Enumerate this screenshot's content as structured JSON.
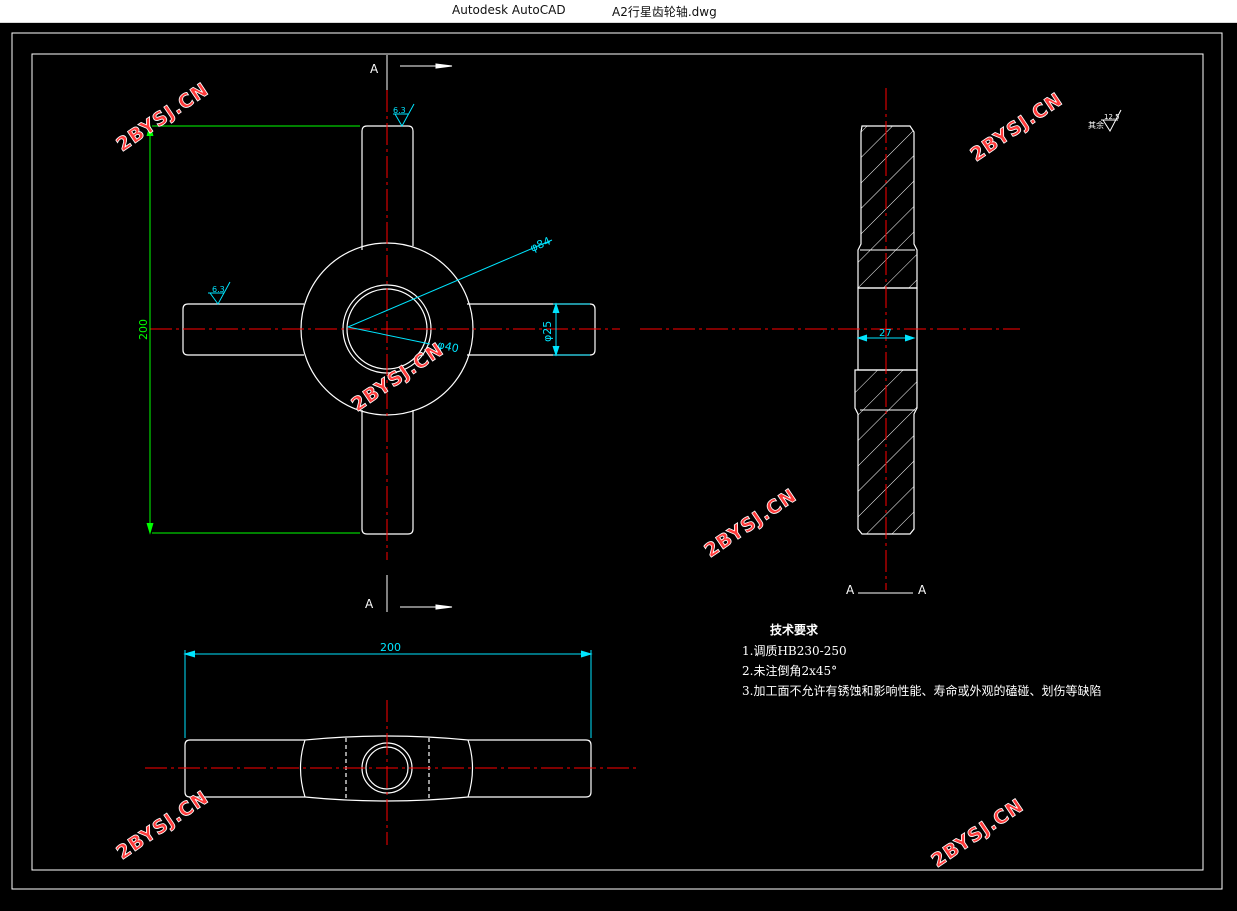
{
  "window": {
    "app_title": "Autodesk AutoCAD",
    "file_title": "A2行星齿轮轴.dwg"
  },
  "drawing": {
    "section_letter": "A",
    "section_label_left": "A",
    "section_label_right": "A",
    "roughness_top": "6.3",
    "roughness_left": "6.3",
    "roughness_other": "其余",
    "roughness_other_value": "12.5",
    "dim_height": "200",
    "dim_dia_outer": "φ84",
    "dim_dia_inner": "φ40",
    "dim_dia_arm": "φ25",
    "dim_width_section": "27",
    "dim_length_bottom": "200"
  },
  "tech_requirements": {
    "title": "技术要求",
    "items": [
      "1.调质HB230-250",
      "2.未注倒角2x45°",
      "3.加工面不允许有锈蚀和影响性能、寿命或外观的磕碰、划伤等缺陷"
    ]
  },
  "watermark": "2BYSJ.CN",
  "colors": {
    "line": "#ffffff",
    "center": "#ff0000",
    "dim_cyan": "#00e5ff",
    "dim_green": "#00ff00",
    "watermark": "#ff3b3b"
  }
}
